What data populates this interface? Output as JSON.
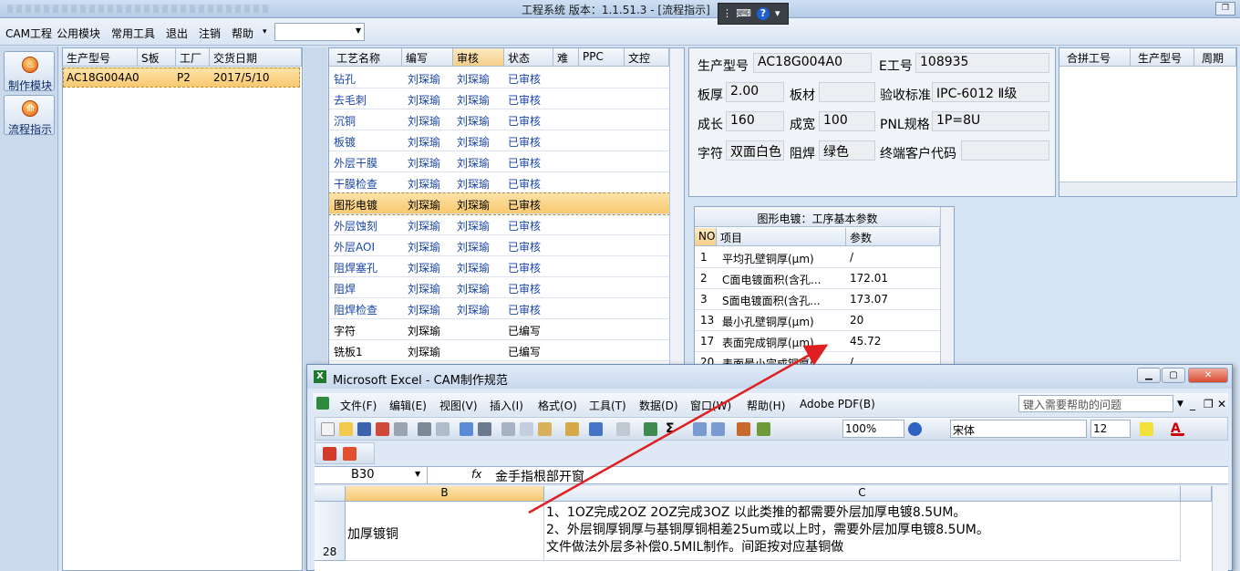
{
  "window": {
    "title": "工程系统   版本：1.1.51.3 - [流程指示]"
  },
  "menubar": {
    "items": [
      "CAM工程",
      "公用模块",
      "常用工具",
      "退出",
      "注销",
      "帮助"
    ],
    "help_arrow": "▾"
  },
  "nav": {
    "buttons": [
      {
        "label": "制作模块"
      },
      {
        "label": "流程指示"
      }
    ]
  },
  "job_grid": {
    "headers": [
      "生产型号",
      "S板",
      "工厂",
      "交货日期"
    ],
    "rows": [
      [
        "AC18G004A0",
        "",
        "P2",
        "2017/5/10"
      ]
    ]
  },
  "process_grid": {
    "headers": [
      "工艺名称",
      "编写",
      "审核",
      "状态",
      "难",
      "PPC",
      "文控"
    ],
    "rows": [
      [
        "钻孔",
        "刘琛瑜",
        "刘琛瑜",
        "已审核"
      ],
      [
        "去毛刺",
        "刘琛瑜",
        "刘琛瑜",
        "已审核"
      ],
      [
        "沉铜",
        "刘琛瑜",
        "刘琛瑜",
        "已审核"
      ],
      [
        "板镀",
        "刘琛瑜",
        "刘琛瑜",
        "已审核"
      ],
      [
        "外层干膜",
        "刘琛瑜",
        "刘琛瑜",
        "已审核"
      ],
      [
        "干膜检查",
        "刘琛瑜",
        "刘琛瑜",
        "已审核"
      ],
      [
        "图形电镀",
        "刘琛瑜",
        "刘琛瑜",
        "已审核"
      ],
      [
        "外层蚀刻",
        "刘琛瑜",
        "刘琛瑜",
        "已审核"
      ],
      [
        "外层AOI",
        "刘琛瑜",
        "刘琛瑜",
        "已审核"
      ],
      [
        "阻焊塞孔",
        "刘琛瑜",
        "刘琛瑜",
        "已审核"
      ],
      [
        "阻焊",
        "刘琛瑜",
        "刘琛瑜",
        "已审核"
      ],
      [
        "阻焊检查",
        "刘琛瑜",
        "刘琛瑜",
        "已审核"
      ],
      [
        "字符",
        "刘琛瑜",
        "",
        "已编写"
      ],
      [
        "铣板1",
        "刘琛瑜",
        "",
        "已编写"
      ]
    ]
  },
  "info": {
    "model_label": "生产型号",
    "model": "AC18G004A0",
    "eno_label": "E工号",
    "eno": "108935",
    "thick_label": "板厚",
    "thick": "2.00",
    "material_label": "板材",
    "material": "",
    "std_label": "验收标准",
    "std": "IPC-6012 Ⅱ级",
    "len_label": "成长",
    "len": "160",
    "wid_label": "成宽",
    "wid": "100",
    "pnl_label": "PNL规格",
    "pnl": "1P=8U",
    "silk_label": "字符",
    "silk": "双面白色",
    "mask_label": "阻焊",
    "mask": "绿色",
    "cust_label": "终端客户代码",
    "cust": ""
  },
  "merge_grid": {
    "headers": [
      "合拼工号",
      "生产型号",
      "周期"
    ]
  },
  "param_grid": {
    "title": "图形电镀：工序基本参数",
    "headers": [
      "NO",
      "项目",
      "参数"
    ],
    "rows": [
      [
        "1",
        "平均孔壁铜厚(μm)",
        "/"
      ],
      [
        "2",
        "C面电镀面积(含孔...",
        "172.01"
      ],
      [
        "3",
        "S面电镀面积(含孔...",
        "173.07"
      ],
      [
        "13",
        "最小孔壁铜厚(μm)",
        "20"
      ],
      [
        "17",
        "表面完成铜厚(μm)",
        "45.72"
      ],
      [
        "20",
        "表面最小完成铜厚(",
        "/"
      ]
    ]
  },
  "excel": {
    "title": "Microsoft Excel - CAM制作规范",
    "menu": [
      "文件(F)",
      "编辑(E)",
      "视图(V)",
      "插入(I)",
      "格式(O)",
      "工具(T)",
      "数据(D)",
      "窗口(W)",
      "帮助(H)",
      "Adobe PDF(B)"
    ],
    "help_placeholder": "键入需要帮助的问题",
    "zoom": "100%",
    "font": "宋体",
    "font_size": "12",
    "name_box": "B30",
    "fx": "fx",
    "formula": "金手指根部开窗",
    "columns": [
      "B",
      "C"
    ],
    "row_num": "28",
    "cell_b": "加厚镀铜",
    "cell_c": [
      "1、1OZ完成2OZ  2OZ完成3OZ  以此类推的都需要外层加厚电镀8.5UM。",
      "2、外层铜厚铜厚与基铜厚铜相差25um或以上时，需要外层加厚电镀8.5UM。",
      "文件做法外层多补偿0.5MIL制作。间距按对应基铜做"
    ]
  },
  "colors": {
    "selected": "#f8c870",
    "accent_blue": "#1b46a8",
    "arrow": "#e02020"
  }
}
